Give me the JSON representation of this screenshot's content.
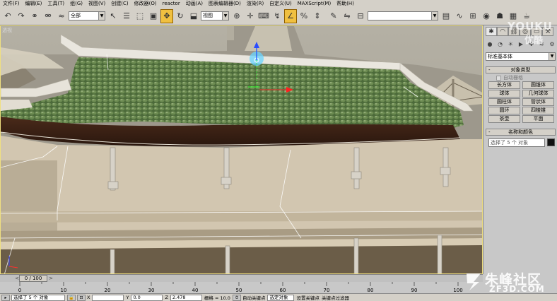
{
  "menubar": {
    "items": [
      "文件(F)",
      "编辑(E)",
      "工具(T)",
      "组(G)",
      "视图(V)",
      "创建(C)",
      "修改器(O)",
      "reactor",
      "动画(A)",
      "图表编辑器(D)",
      "渲染(R)",
      "自定义(U)",
      "MAXScript(M)",
      "帮助(H)"
    ]
  },
  "toolbar": {
    "selection_filter": "全部",
    "reference_coord": "视图",
    "named_selection": ""
  },
  "viewport": {
    "label": "透视"
  },
  "command_panel": {
    "primitive_type": "标准基本体",
    "object_type_header": "对象类型",
    "auto_grid": "自动栅格",
    "objects": [
      "长方体",
      "圆锥体",
      "球体",
      "几何球体",
      "圆柱体",
      "管状体",
      "圆环",
      "四棱锥",
      "茶壶",
      "平面"
    ],
    "name_color_header": "名称和颜色",
    "name_value": "选择了 5 个 对象",
    "colors": {
      "object_color": "#111111"
    }
  },
  "timeslider": {
    "frame_label": "0 / 100",
    "prev": "<",
    "next": ">"
  },
  "trackbar": {
    "ticks": [
      "0",
      "10",
      "20",
      "30",
      "40",
      "50",
      "60",
      "70",
      "80",
      "90",
      "100"
    ]
  },
  "statusbar": {
    "selection_text": "选择了 5 个 对象",
    "x_label": "X",
    "x_value": "",
    "y_label": "Y",
    "y_value": "0.0",
    "z_label": "Z",
    "z_value": "2.478",
    "grid_text": "栅格 = 10.0",
    "auto_key": "自动关键点",
    "selected_set": "选定对象",
    "set_key": "设置关键点",
    "key_filter": "关键点过滤器"
  },
  "watermarks": {
    "top_en": "YOUKU",
    "top_cn": "优酷",
    "bottom_cn": "朱峰社区",
    "bottom_en": "ZF3D.COM"
  }
}
